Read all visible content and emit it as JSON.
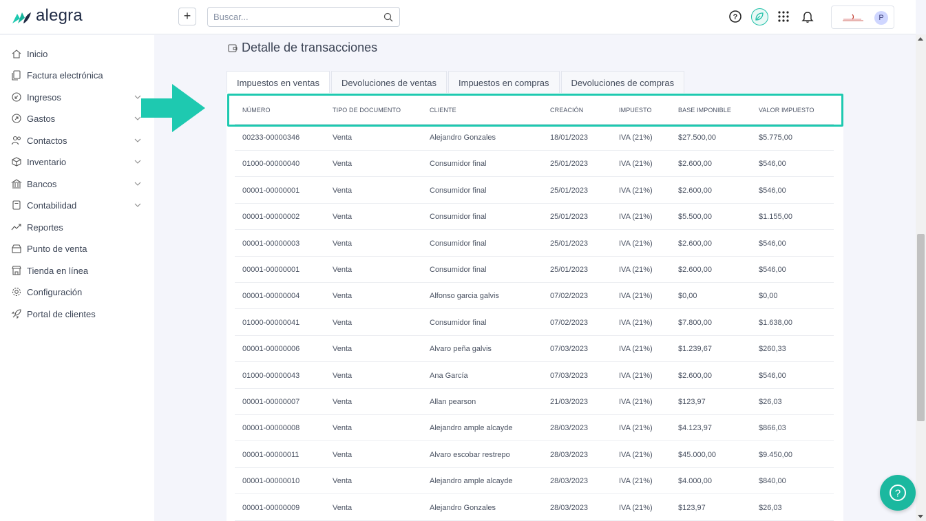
{
  "header": {
    "brand": "alegra",
    "add_label": "+",
    "search_placeholder": "Buscar...",
    "avatar_initial": "P"
  },
  "sidebar": {
    "items": [
      {
        "label": "Inicio",
        "icon": "home-icon",
        "expandable": false
      },
      {
        "label": "Factura electrónica",
        "icon": "documents-icon",
        "expandable": false
      },
      {
        "label": "Ingresos",
        "icon": "income-icon",
        "expandable": true
      },
      {
        "label": "Gastos",
        "icon": "expense-icon",
        "expandable": true
      },
      {
        "label": "Contactos",
        "icon": "contacts-icon",
        "expandable": true
      },
      {
        "label": "Inventario",
        "icon": "box-icon",
        "expandable": true
      },
      {
        "label": "Bancos",
        "icon": "bank-icon",
        "expandable": true
      },
      {
        "label": "Contabilidad",
        "icon": "ledger-icon",
        "expandable": true
      },
      {
        "label": "Reportes",
        "icon": "chart-line-icon",
        "expandable": false
      },
      {
        "label": "Punto de venta",
        "icon": "pos-icon",
        "expandable": false
      },
      {
        "label": "Tienda en línea",
        "icon": "store-icon",
        "expandable": false
      },
      {
        "label": "Configuración",
        "icon": "gear-icon",
        "expandable": false
      },
      {
        "label": "Portal de clientes",
        "icon": "rocket-icon",
        "expandable": false
      }
    ]
  },
  "main": {
    "title": "Detalle de transacciones",
    "tabs": [
      {
        "label": "Impuestos en ventas",
        "active": true
      },
      {
        "label": "Devoluciones de ventas",
        "active": false
      },
      {
        "label": "Impuestos en compras",
        "active": false
      },
      {
        "label": "Devoluciones de compras",
        "active": false
      }
    ],
    "table": {
      "headers": [
        "NÚMERO",
        "TIPO DE DOCUMENTO",
        "CLIENTE",
        "CREACIÓN",
        "IMPUESTO",
        "BASE IMPONIBLE",
        "VALOR IMPUESTO"
      ],
      "rows": [
        [
          "00233-00000346",
          "Venta",
          "Alejandro Gonzales",
          "18/01/2023",
          "IVA (21%)",
          "$27.500,00",
          "$5.775,00"
        ],
        [
          "01000-00000040",
          "Venta",
          "Consumidor final",
          "25/01/2023",
          "IVA (21%)",
          "$2.600,00",
          "$546,00"
        ],
        [
          "00001-00000001",
          "Venta",
          "Consumidor final",
          "25/01/2023",
          "IVA (21%)",
          "$2.600,00",
          "$546,00"
        ],
        [
          "00001-00000002",
          "Venta",
          "Consumidor final",
          "25/01/2023",
          "IVA (21%)",
          "$5.500,00",
          "$1.155,00"
        ],
        [
          "00001-00000003",
          "Venta",
          "Consumidor final",
          "25/01/2023",
          "IVA (21%)",
          "$2.600,00",
          "$546,00"
        ],
        [
          "00001-00000001",
          "Venta",
          "Consumidor final",
          "25/01/2023",
          "IVA (21%)",
          "$2.600,00",
          "$546,00"
        ],
        [
          "00001-00000004",
          "Venta",
          "Alfonso garcia galvis",
          "07/02/2023",
          "IVA (21%)",
          "$0,00",
          "$0,00"
        ],
        [
          "01000-00000041",
          "Venta",
          "Consumidor final",
          "07/02/2023",
          "IVA (21%)",
          "$7.800,00",
          "$1.638,00"
        ],
        [
          "00001-00000006",
          "Venta",
          "Alvaro peña galvis",
          "07/03/2023",
          "IVA (21%)",
          "$1.239,67",
          "$260,33"
        ],
        [
          "01000-00000043",
          "Venta",
          "Ana García",
          "07/03/2023",
          "IVA (21%)",
          "$2.600,00",
          "$546,00"
        ],
        [
          "00001-00000007",
          "Venta",
          "Allan pearson",
          "21/03/2023",
          "IVA (21%)",
          "$123,97",
          "$26,03"
        ],
        [
          "00001-00000008",
          "Venta",
          "Alejandro ample alcayde",
          "28/03/2023",
          "IVA (21%)",
          "$4.123,97",
          "$866,03"
        ],
        [
          "00001-00000011",
          "Venta",
          "Alvaro escobar restrepo",
          "28/03/2023",
          "IVA (21%)",
          "$45.000,00",
          "$9.450,00"
        ],
        [
          "00001-00000010",
          "Venta",
          "Alejandro ample alcayde",
          "28/03/2023",
          "IVA (21%)",
          "$4.000,00",
          "$840,00"
        ],
        [
          "00001-00000009",
          "Venta",
          "Alejandro Gonzales",
          "28/03/2023",
          "IVA (21%)",
          "$123,97",
          "$26,03"
        ]
      ]
    }
  },
  "colors": {
    "accent": "#1ec9b0",
    "brand_dark": "#1f2a44",
    "text": "#4a5262"
  }
}
